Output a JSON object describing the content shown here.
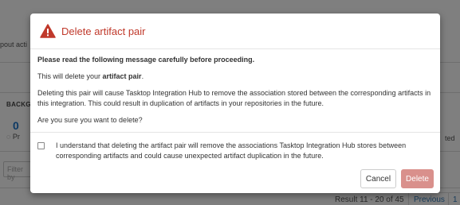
{
  "background": {
    "partial_text_top": "pout acti",
    "section_heading": "BACKG",
    "count": "0",
    "progress_label": "Pr",
    "right_status": "ted",
    "filter_placeholder": "Filter by",
    "pagination": {
      "result_text": "Result 11 - 20 of 45",
      "previous_label": "Previous",
      "page_number": "1"
    }
  },
  "modal": {
    "title": "Delete artifact pair",
    "icon": "warning-triangle-icon",
    "lead": "Please read the following message carefully before proceeding.",
    "line1_prefix": "This will delete your ",
    "line1_bold": "artifact pair",
    "line1_suffix": ".",
    "paragraph": "Deleting this pair will cause Tasktop Integration Hub to remove the association stored between the corresponding artifacts in this integration. This could result in duplication of artifacts in your repositories in the future.",
    "question": "Are you sure you want to delete?",
    "checkbox_label": "I understand that deleting the artifact pair will remove the associations Tasktop Integration Hub stores between corresponding artifacts and could cause unexpected artifact duplication in the future.",
    "checkbox_checked": false,
    "cancel_label": "Cancel",
    "delete_label": "Delete"
  },
  "colors": {
    "title": "#c0392b",
    "delete_button_disabled": "#d9908c",
    "overlay": "rgba(0,0,0,0.5)"
  }
}
